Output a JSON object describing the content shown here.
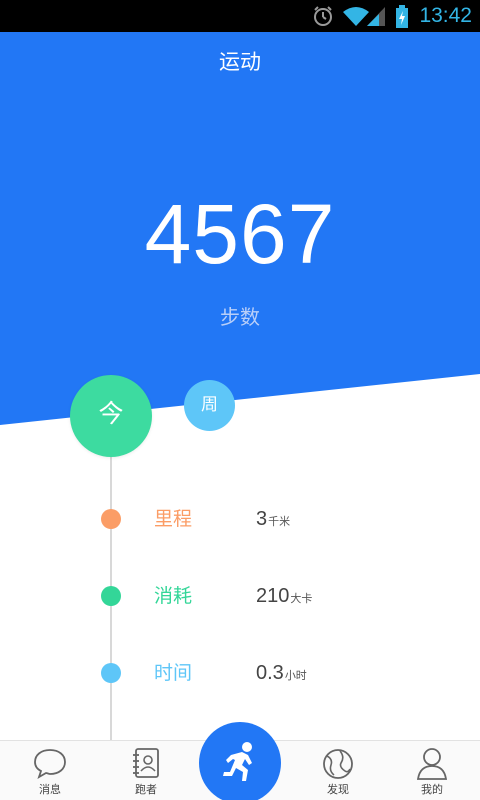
{
  "status_bar": {
    "time": "13:42"
  },
  "header": {
    "title": "运动"
  },
  "summary": {
    "steps": "4567",
    "steps_label": "步数"
  },
  "period": {
    "today_label": "今",
    "week_label": "周"
  },
  "stats": [
    {
      "label": "里程",
      "value": "3",
      "unit": "千米",
      "color": "#fb9d66"
    },
    {
      "label": "消耗",
      "value": "210",
      "unit": "大卡",
      "color": "#33d698"
    },
    {
      "label": "时间",
      "value": "0.3",
      "unit": "小时",
      "color": "#5ec6f8"
    }
  ],
  "nav": {
    "items": [
      {
        "label": "消息",
        "icon": "chat-bubble-icon"
      },
      {
        "label": "跑者",
        "icon": "contacts-book-icon"
      },
      {
        "label": "",
        "icon": "running-man-icon"
      },
      {
        "label": "发现",
        "icon": "globe-icon"
      },
      {
        "label": "我的",
        "icon": "person-icon"
      }
    ]
  },
  "colors": {
    "primary": "#2277f5",
    "today": "#3ddba0",
    "week": "#5ec6f8",
    "status_clock": "#33b5e5"
  }
}
